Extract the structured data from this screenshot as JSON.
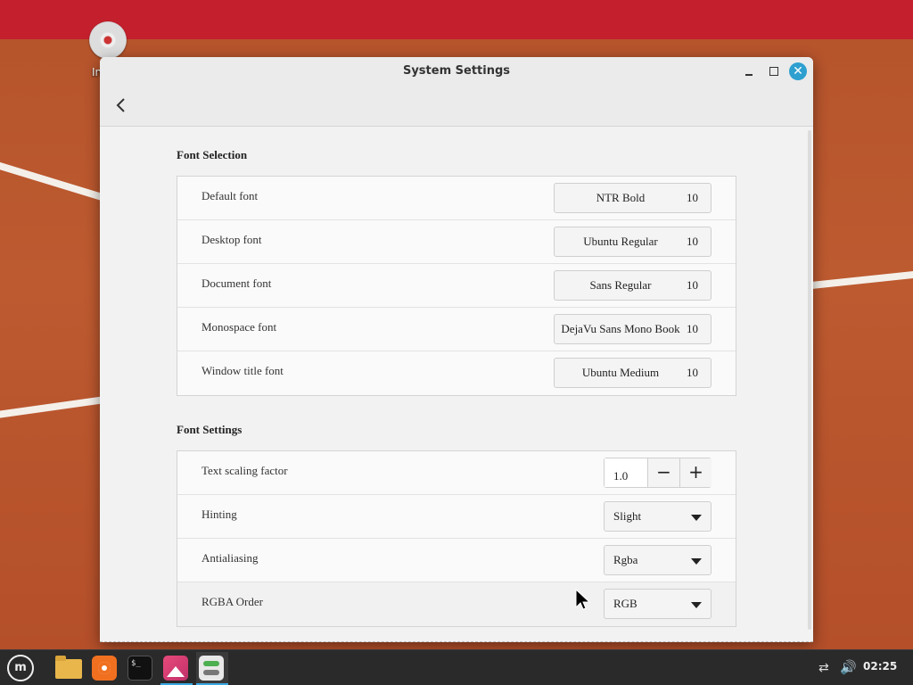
{
  "desktop": {
    "icon_label": "In"
  },
  "window": {
    "title": "System Settings",
    "back_icon": "chevron-left-icon"
  },
  "font_selection": {
    "title": "Font Selection",
    "rows": [
      {
        "label": "Default font",
        "font": "NTR Bold",
        "size": "10"
      },
      {
        "label": "Desktop font",
        "font": "Ubuntu Regular",
        "size": "10"
      },
      {
        "label": "Document font",
        "font": "Sans Regular",
        "size": "10"
      },
      {
        "label": "Monospace font",
        "font": "DejaVu Sans Mono Book",
        "size": "10"
      },
      {
        "label": "Window title font",
        "font": "Ubuntu Medium",
        "size": "10"
      }
    ]
  },
  "font_settings": {
    "title": "Font Settings",
    "scaling": {
      "label": "Text scaling factor",
      "value": "1.0",
      "minus": "−",
      "plus": "+"
    },
    "hinting": {
      "label": "Hinting",
      "value": "Slight"
    },
    "antialiasing": {
      "label": "Antialiasing",
      "value": "Rgba"
    },
    "rgba_order": {
      "label": "RGBA Order",
      "value": "RGB"
    }
  },
  "taskbar": {
    "menu_label": "m",
    "terminal_prompt": "$_",
    "clock": "02:25"
  },
  "colors": {
    "accent": "#3aa7e0",
    "close_button": "#2ea0d0",
    "panel_top": "#c41f2d",
    "wallpaper": "#b9582f"
  }
}
